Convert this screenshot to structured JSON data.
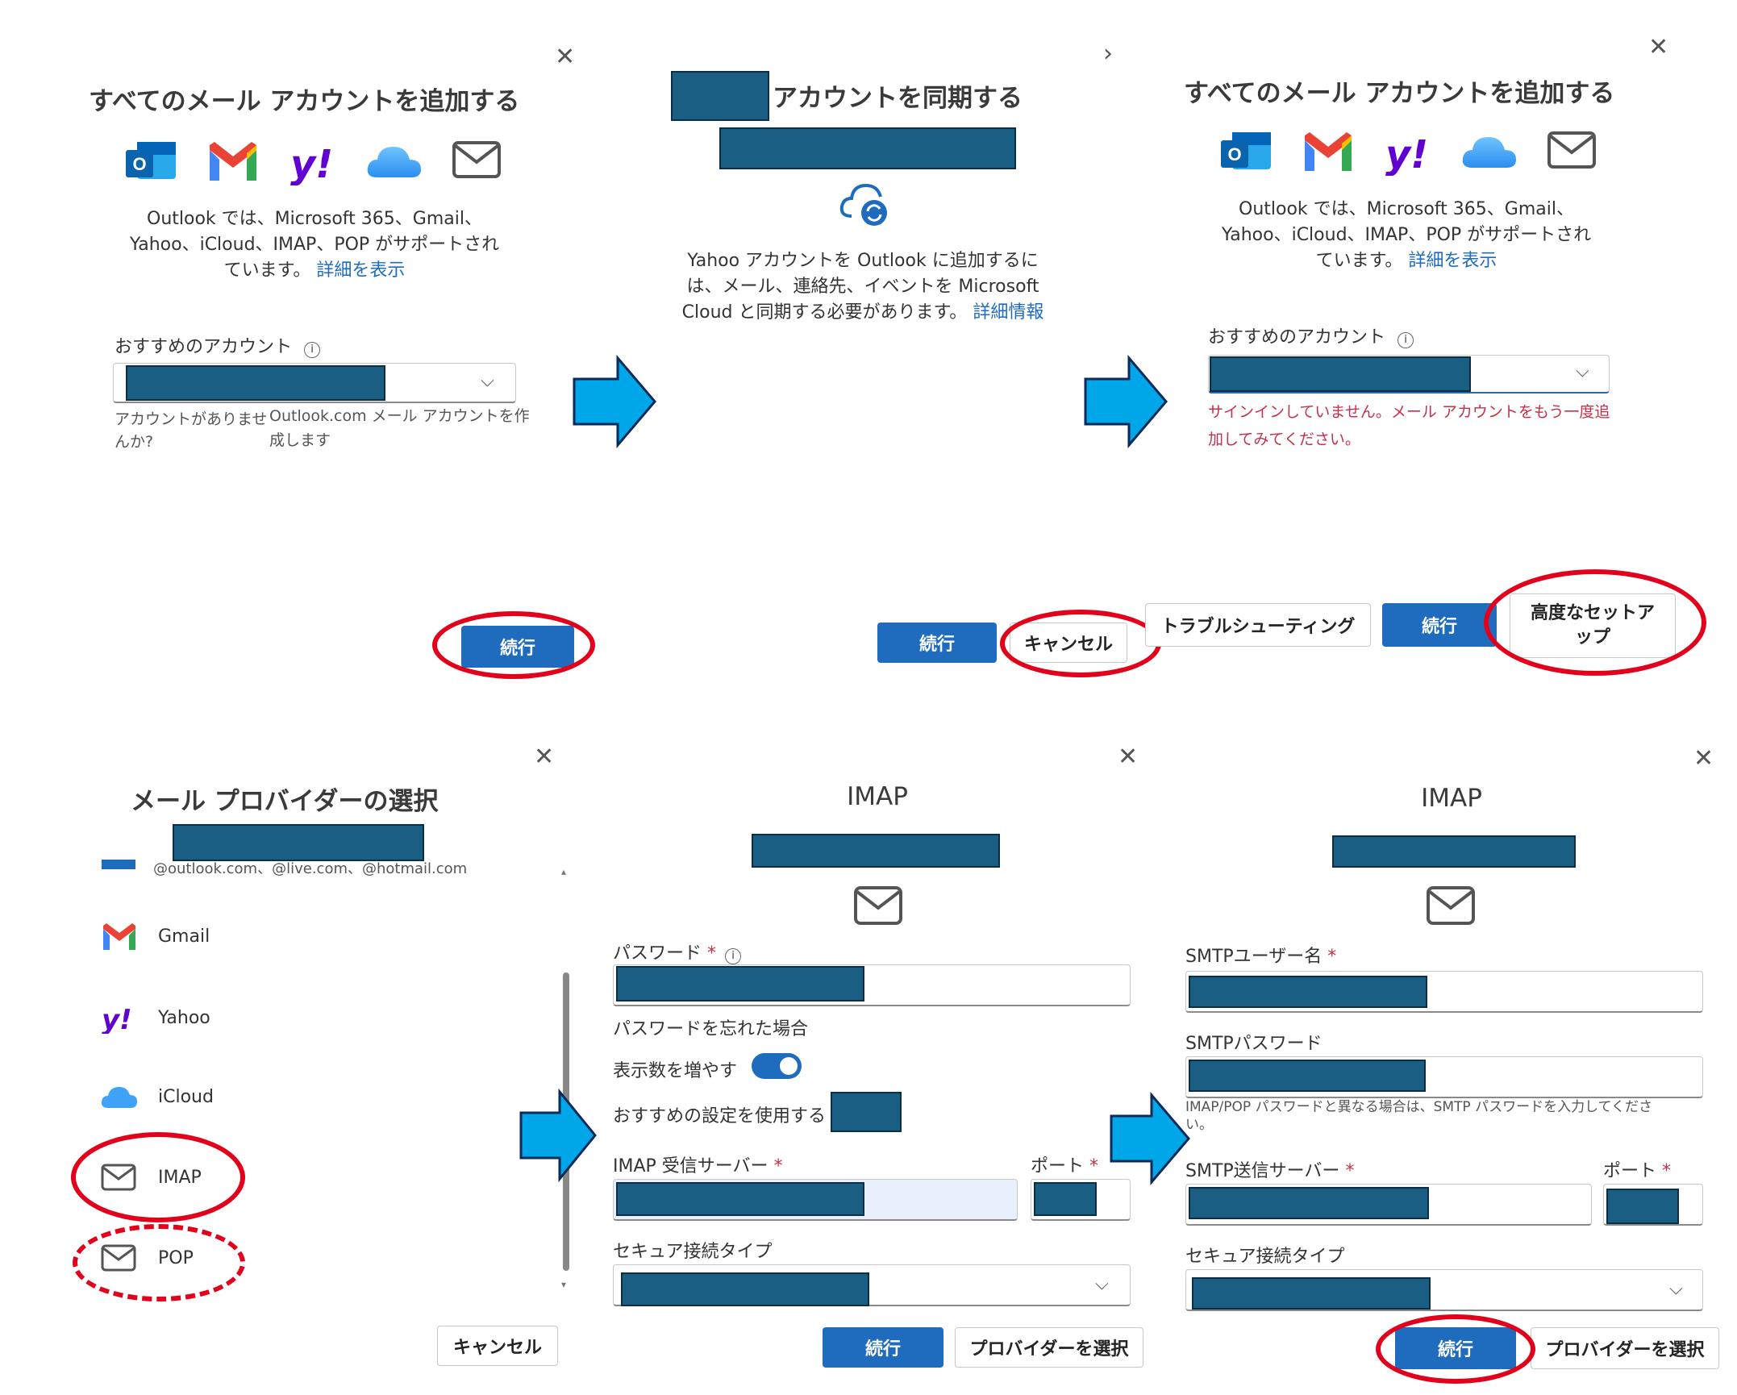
{
  "panel1": {
    "title": "すべてのメール アカウントを追加する",
    "description_lines": [
      "Outlook では、Microsoft 365、Gmail、",
      "Yahoo、iCloud、IMAP、POP がサポートされ",
      "ています。"
    ],
    "details_link": "詳細を表示",
    "recommended_label": "おすすめのアカウント",
    "no_account_text_line1": "アカウントがありませ",
    "no_account_text_line2": "んか?",
    "create_link_line1": "Outlook.com メール アカウントを作",
    "create_link_line2": "成します",
    "continue_label": "続行"
  },
  "panel2": {
    "title": "アカウントを同期する",
    "description_lines": [
      "Yahoo アカウントを Outlook に追加するに",
      "は、メール、連絡先、イベントを Microsoft",
      "Cloud と同期する必要があります。"
    ],
    "details_link": "詳細情報",
    "continue_label": "続行",
    "cancel_label": "キャンセル"
  },
  "panel3": {
    "title": "すべてのメール アカウントを追加する",
    "description_lines": [
      "Outlook では、Microsoft 365、Gmail、",
      "Yahoo、iCloud、IMAP、POP がサポートされ",
      "ています。"
    ],
    "details_link": "詳細を表示",
    "recommended_label": "おすすめのアカウント",
    "error_line1": "サインインしていません。メール アカウントをもう一度追",
    "error_line2": "加してみてください。",
    "troubleshoot_label": "トラブルシューティング",
    "continue_label": "続行",
    "advanced_line1": "高度なセットア",
    "advanced_line2": "ップ"
  },
  "panel4": {
    "title": "メール プロバイダーの選択",
    "outlook_domains": "@outlook.com、@live.com、@hotmail.com",
    "providers": [
      "Gmail",
      "Yahoo",
      "iCloud",
      "IMAP",
      "POP"
    ],
    "cancel_label": "キャンセル"
  },
  "panel5": {
    "title": "IMAP",
    "password_label": "パスワード",
    "required_mark": "*",
    "forgot_link": "パスワードを忘れた場合",
    "show_more_label": "表示数を増やす",
    "use_recommended_label": "おすすめの設定を使用する",
    "incoming_label": "IMAP 受信サーバー",
    "port_label": "ポート",
    "secure_label": "セキュア接続タイプ",
    "continue_label": "続行",
    "select_provider_label": "プロバイダーを選択"
  },
  "panel6": {
    "title": "IMAP",
    "smtp_user_label": "SMTPユーザー名",
    "smtp_password_label": "SMTPパスワード",
    "smtp_hint_line1": "IMAP/POP パスワードと異なる場合は、SMTP パスワードを入力してくださ",
    "smtp_hint_line2": "い。",
    "smtp_server_label": "SMTP送信サーバー",
    "port_label": "ポート",
    "secure_label": "セキュア接続タイプ",
    "continue_label": "続行",
    "select_provider_label": "プロバイダーを選択",
    "required_mark": "*"
  },
  "colors": {
    "accent": "#1f6cbf",
    "highlight_oval": "#e2001a",
    "arrow": "#00a7e8",
    "redaction": "#1b5e83"
  }
}
